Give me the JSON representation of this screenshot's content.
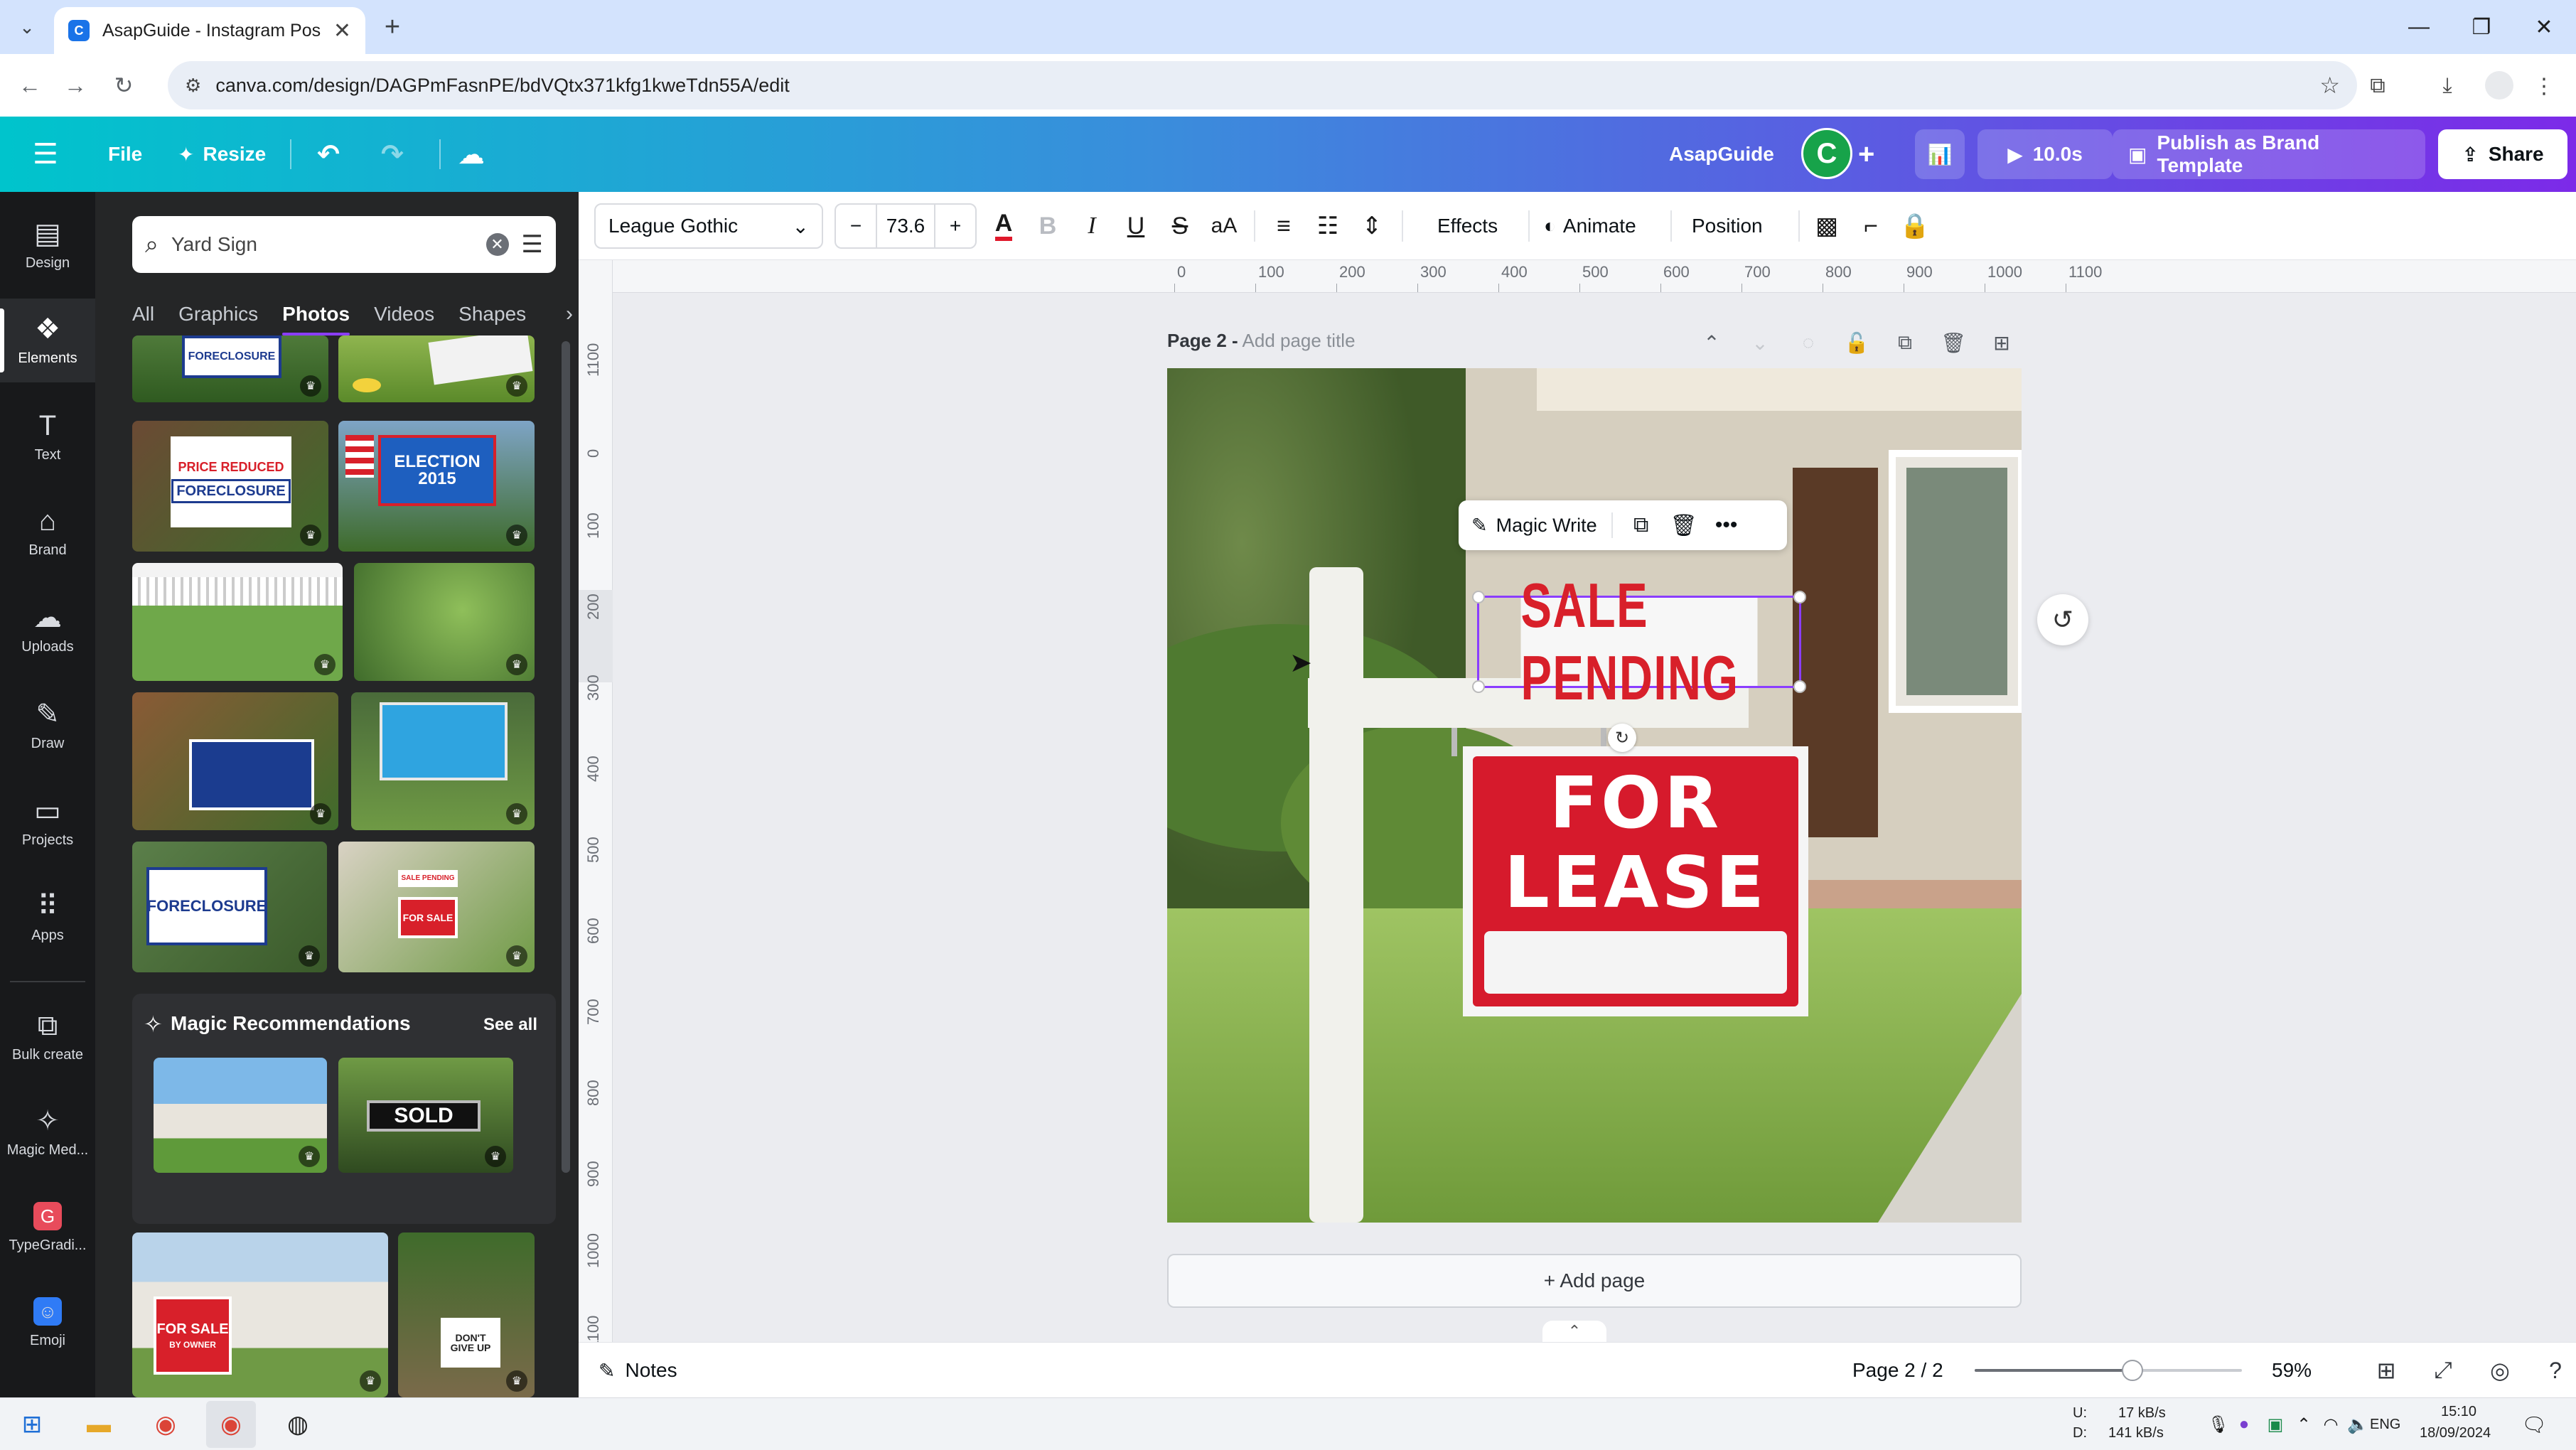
{
  "browser": {
    "tab_title": "AsapGuide - Instagram Post",
    "url": "canva.com/design/DAGPmFasnPE/bdVQtx371kfg1kweTdn55A/edit"
  },
  "header": {
    "file_label": "File",
    "resize_label": "Resize",
    "team_name": "AsapGuide",
    "avatar_letter": "C",
    "timer_label": "10.0s",
    "publish_label": "Publish as Brand Template",
    "share_label": "Share"
  },
  "rail": [
    {
      "label": "Design",
      "icon": "design-icon"
    },
    {
      "label": "Elements",
      "icon": "elements-icon"
    },
    {
      "label": "Text",
      "icon": "text-icon"
    },
    {
      "label": "Brand",
      "icon": "brand-icon"
    },
    {
      "label": "Uploads",
      "icon": "uploads-icon"
    },
    {
      "label": "Draw",
      "icon": "draw-icon"
    },
    {
      "label": "Projects",
      "icon": "projects-icon"
    },
    {
      "label": "Apps",
      "icon": "apps-icon"
    },
    {
      "label": "Bulk create",
      "icon": "bulk-create-icon"
    },
    {
      "label": "Magic Med...",
      "icon": "magic-media-icon"
    },
    {
      "label": "TypeGradi...",
      "icon": "typegradient-icon"
    },
    {
      "label": "Emoji",
      "icon": "emoji-icon"
    }
  ],
  "panel": {
    "search_value": "Yard Sign",
    "tabs": [
      "All",
      "Graphics",
      "Photos",
      "Videos",
      "Shapes"
    ],
    "active_tab": "Photos",
    "magic_title": "Magic Recommendations",
    "see_all": "See all",
    "sign_texts": {
      "price_reduced": "PRICE REDUCED",
      "foreclosure": "FORECLOSURE",
      "election": "ELECTION",
      "election_year": "2015",
      "sale_pending_small": "SALE PENDING",
      "for_sale_small": "FOR SALE",
      "sold": "SOLD",
      "for_sale_owner": "FOR SALE",
      "by_owner": "BY OWNER",
      "dont_give_up": "DON'T GIVE UP"
    }
  },
  "toolbar": {
    "font": "League Gothic",
    "font_size": "73.6",
    "effects": "Effects",
    "animate": "Animate",
    "position": "Position"
  },
  "rulers": {
    "top": [
      "0",
      "100",
      "200",
      "300",
      "400",
      "500",
      "600",
      "700",
      "800",
      "900",
      "1000",
      "1100"
    ],
    "left": [
      "1100",
      "0",
      "100",
      "200",
      "300",
      "400",
      "500",
      "600",
      "700",
      "800",
      "900",
      "1000",
      "1100"
    ]
  },
  "page": {
    "label": "Page 2 -",
    "title_placeholder": "Add page title",
    "add_page": "+ Add page"
  },
  "canvas": {
    "selected_text": "SALE PENDING",
    "sign_line1": "FOR",
    "sign_line2": "LEASE",
    "magic_write": "Magic Write"
  },
  "bottom": {
    "notes": "Notes",
    "page_indicator": "Page 2 / 2",
    "zoom": "59%",
    "zoom_fraction": 0.59
  },
  "taskbar": {
    "net_up_label": "U:",
    "net_up": "17 kB/s",
    "net_down_label": "D:",
    "net_down": "141 kB/s",
    "lang": "ENG",
    "time": "15:10",
    "date": "18/09/2024"
  },
  "colors": {
    "header_start": "#00c4cc",
    "header_end": "#7c2ae8",
    "accent_purple": "#8b3dff",
    "sign_red": "#e0192c"
  }
}
